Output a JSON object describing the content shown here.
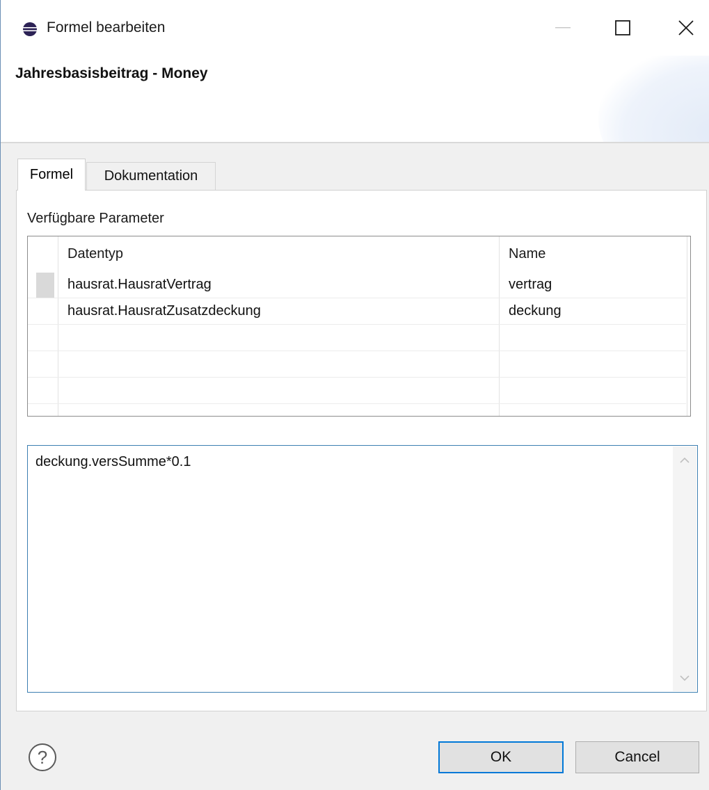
{
  "window": {
    "title": "Formel bearbeiten",
    "controls": {
      "minimize": "minimize-icon",
      "maximize": "maximize-icon",
      "close": "close-icon"
    }
  },
  "header": {
    "title": "Jahresbasisbeitrag - Money"
  },
  "tabs": [
    {
      "label": "Formel",
      "active": true
    },
    {
      "label": "Dokumentation",
      "active": false
    }
  ],
  "parameters": {
    "section_label": "Verfügbare Parameter",
    "columns": [
      "Datentyp",
      "Name"
    ],
    "rows": [
      {
        "datatype": "hausrat.HausratVertrag",
        "name": "vertrag"
      },
      {
        "datatype": "hausrat.HausratZusatzdeckung",
        "name": "deckung"
      }
    ]
  },
  "formula": {
    "value": "deckung.versSumme*0.1"
  },
  "footer": {
    "help_icon": "help-icon",
    "ok_label": "OK",
    "cancel_label": "Cancel"
  },
  "colors": {
    "accent": "#0078d7",
    "editor_border": "#3c7fb1",
    "window_border": "#6b8fb5"
  }
}
